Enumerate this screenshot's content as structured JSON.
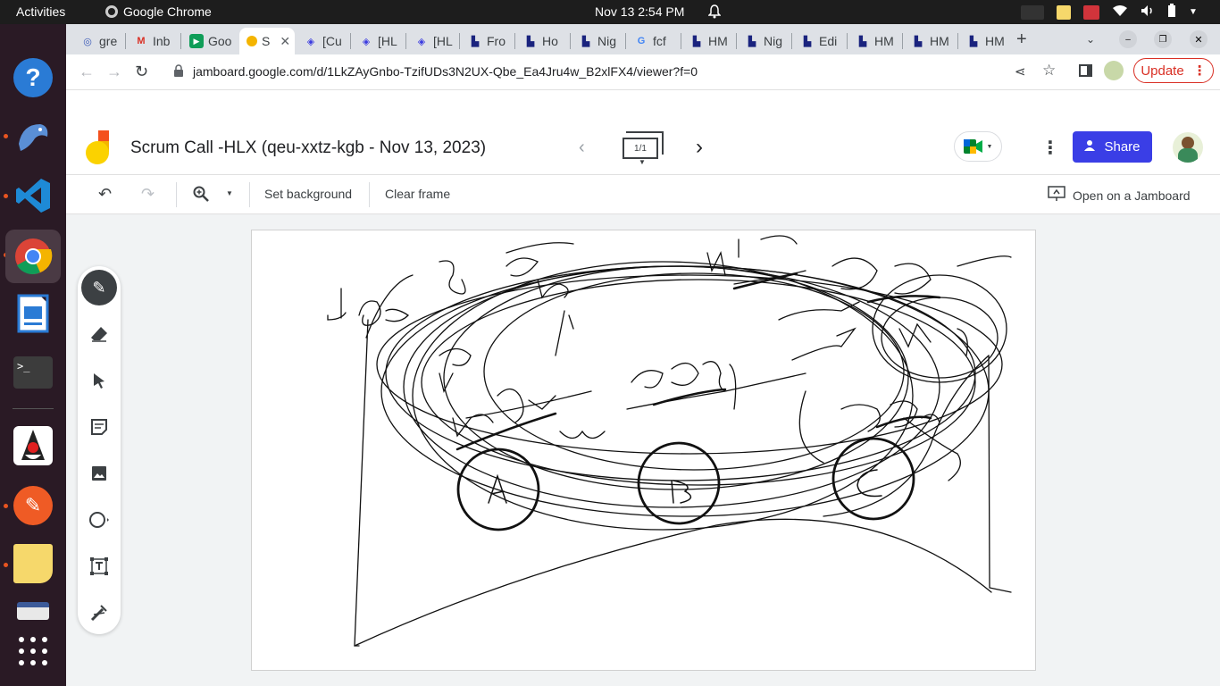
{
  "os": {
    "activities": "Activities",
    "app_name": "Google Chrome",
    "clock": "Nov 13  2:54 PM"
  },
  "tabs": [
    {
      "label": "gre"
    },
    {
      "label": "Inb"
    },
    {
      "label": "Goo"
    },
    {
      "label": "S"
    },
    {
      "label": "[Cu"
    },
    {
      "label": "[HL"
    },
    {
      "label": "[HL"
    },
    {
      "label": "Fro"
    },
    {
      "label": "Ho"
    },
    {
      "label": "Nig"
    },
    {
      "label": "fcf"
    },
    {
      "label": "HM"
    },
    {
      "label": "Nig"
    },
    {
      "label": "Edi"
    },
    {
      "label": "HM"
    },
    {
      "label": "HM"
    },
    {
      "label": "HM"
    }
  ],
  "browser": {
    "url": "jamboard.google.com/d/1LkZAyGnbo-TzifUDs3N2UX-Qbe_Ea4Jru4w_B2xlFX4/viewer?f=0",
    "update_label": "Update"
  },
  "jamboard": {
    "title": "Scrum Call -HLX (qeu-xxtz-kgb - Nov 13, 2023)",
    "frame_indicator": "1/1",
    "share_label": "Share",
    "set_background": "Set background",
    "clear_frame": "Clear frame",
    "open_on_jamboard": "Open on a Jamboard"
  },
  "tools": [
    "pen-icon",
    "eraser-icon",
    "select-icon",
    "sticky-note-icon",
    "image-icon",
    "circle-icon",
    "text-box-icon",
    "laser-icon"
  ],
  "colors": {
    "share_blue": "#3a3ee6",
    "update_red": "#d93025",
    "dock_bg": "#2a1a25"
  }
}
